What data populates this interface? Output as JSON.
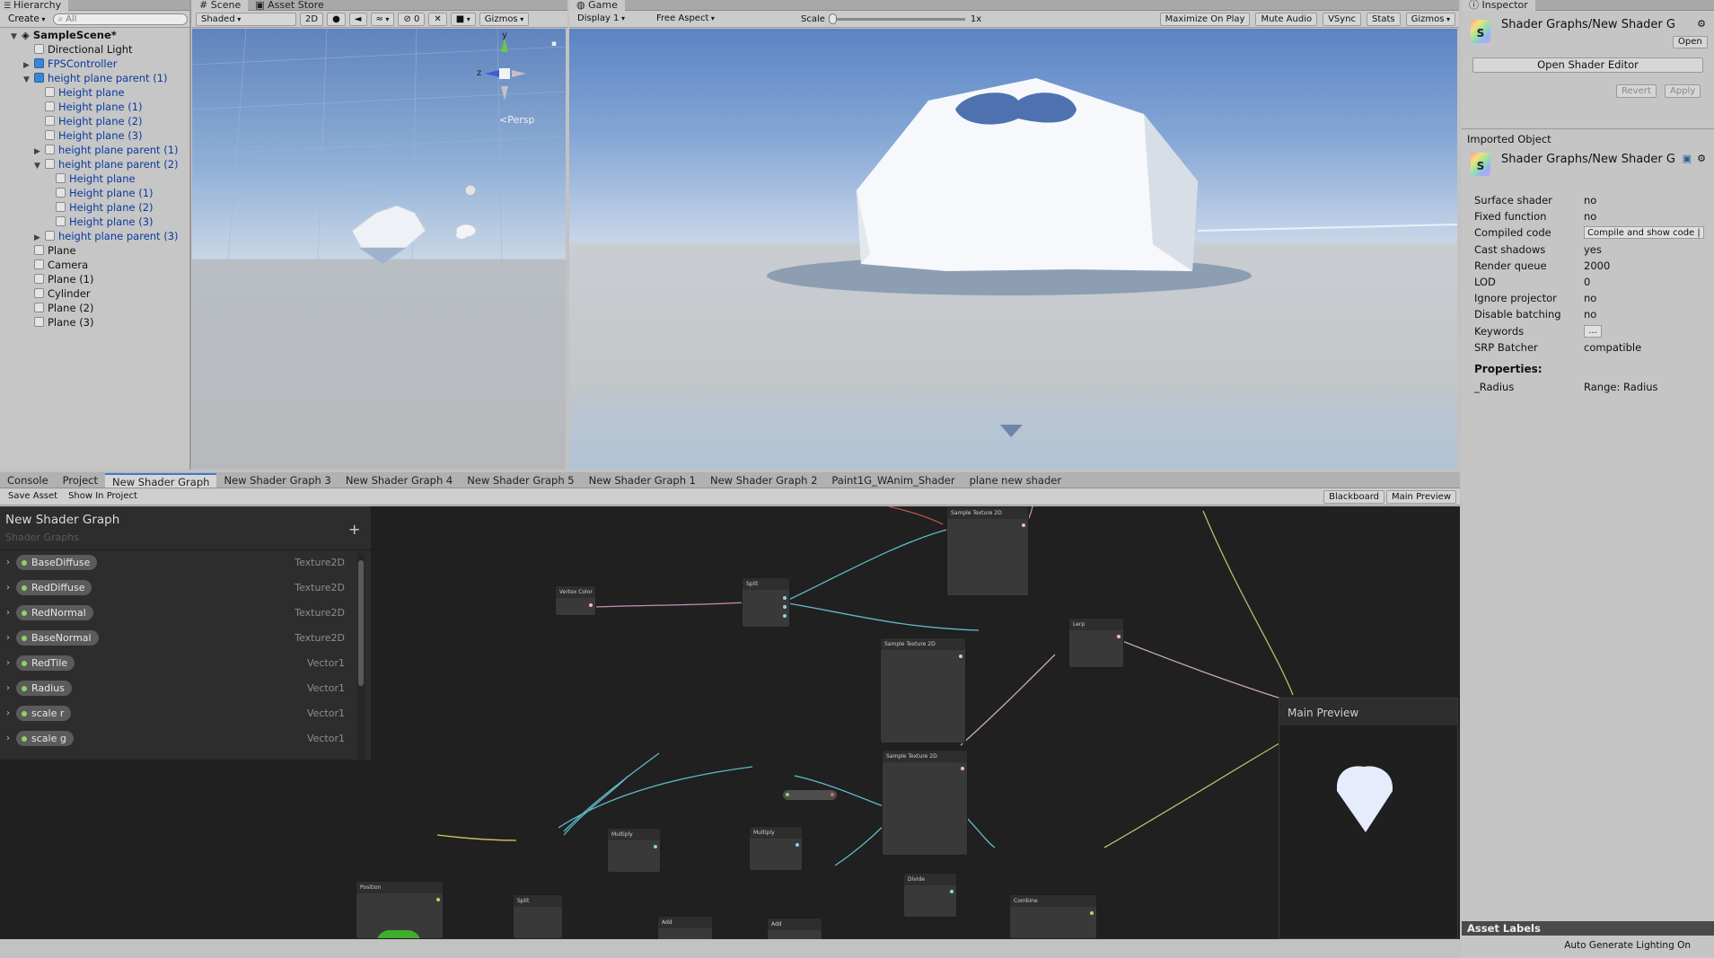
{
  "hierarchy": {
    "tab": "Hierarchy",
    "create_label": "Create",
    "search_placeholder": "All",
    "scene_name": "SampleScene*",
    "items": [
      {
        "label": "Directional Light"
      },
      {
        "label": "FPSController"
      },
      {
        "label": "height plane parent (1)"
      },
      {
        "label": "Height plane"
      },
      {
        "label": "Height plane (1)"
      },
      {
        "label": "Height plane (2)"
      },
      {
        "label": "Height plane (3)"
      },
      {
        "label": "height plane parent (1)"
      },
      {
        "label": "height plane parent (2)"
      },
      {
        "label": "Height plane"
      },
      {
        "label": "Height plane (1)"
      },
      {
        "label": "Height plane (2)"
      },
      {
        "label": "Height plane (3)"
      },
      {
        "label": "height plane parent (3)"
      },
      {
        "label": "Plane"
      },
      {
        "label": "Camera"
      },
      {
        "label": "Plane (1)"
      },
      {
        "label": "Cylinder"
      },
      {
        "label": "Plane (2)"
      },
      {
        "label": "Plane (3)"
      }
    ]
  },
  "scene": {
    "tab_scene": "Scene",
    "tab_asset_store": "Asset Store",
    "shading_mode": "Shaded",
    "mode_2d": "2D",
    "effects_count": "0",
    "gizmos": "Gizmos",
    "persp_label": "Persp",
    "axis_y": "y",
    "axis_z": "z"
  },
  "game": {
    "tab": "Game",
    "display": "Display 1",
    "aspect": "Free Aspect",
    "scale_label": "Scale",
    "scale_value": "1x",
    "maximize": "Maximize On Play",
    "mute": "Mute Audio",
    "vsync": "VSync",
    "stats": "Stats",
    "gizmos": "Gizmos"
  },
  "inspector": {
    "tab": "Inspector",
    "asset_title": "Shader Graphs/New Shader G",
    "open_label": "Open",
    "open_editor_label": "Open Shader Editor",
    "revert_label": "Revert",
    "apply_label": "Apply",
    "imported_object_label": "Imported Object",
    "imported_title": "Shader Graphs/New Shader G",
    "rows": [
      {
        "k": "Surface shader",
        "v": "no"
      },
      {
        "k": "Fixed function",
        "v": "no"
      },
      {
        "k": "Compiled code",
        "v": "Compile and show code |"
      },
      {
        "k": "Cast shadows",
        "v": "yes"
      },
      {
        "k": "Render queue",
        "v": "2000"
      },
      {
        "k": "LOD",
        "v": "0"
      },
      {
        "k": "Ignore projector",
        "v": "no"
      },
      {
        "k": "Disable batching",
        "v": "no"
      },
      {
        "k": "Keywords",
        "v": "..."
      },
      {
        "k": "SRP Batcher",
        "v": "compatible"
      }
    ],
    "properties_label": "Properties:",
    "prop_name": "_Radius",
    "prop_value": "Range: Radius",
    "asset_labels": "Asset Labels",
    "status": "Auto Generate Lighting On"
  },
  "bottom": {
    "tabs": [
      {
        "label": "Console"
      },
      {
        "label": "Project"
      },
      {
        "label": "New Shader Graph"
      },
      {
        "label": "New Shader Graph 3"
      },
      {
        "label": "New Shader Graph 4"
      },
      {
        "label": "New Shader Graph 5"
      },
      {
        "label": "New Shader Graph 1"
      },
      {
        "label": "New Shader Graph 2"
      },
      {
        "label": "Paint1G_WAnim_Shader"
      },
      {
        "label": "plane new shader"
      }
    ],
    "save_asset": "Save Asset",
    "show_in_project": "Show In Project",
    "blackboard_btn": "Blackboard",
    "main_preview_btn": "Main Preview"
  },
  "blackboard": {
    "title": "New Shader Graph",
    "subtitle": "Shader Graphs",
    "properties": [
      {
        "name": "BaseDiffuse",
        "type": "Texture2D"
      },
      {
        "name": "RedDiffuse",
        "type": "Texture2D"
      },
      {
        "name": "RedNormal",
        "type": "Texture2D"
      },
      {
        "name": "BaseNormal",
        "type": "Texture2D"
      },
      {
        "name": "RedTile",
        "type": "Vector1"
      },
      {
        "name": "Radius",
        "type": "Vector1"
      },
      {
        "name": "scale r",
        "type": "Vector1"
      },
      {
        "name": "scale g",
        "type": "Vector1"
      }
    ]
  },
  "graph": {
    "main_preview_title": "Main Preview",
    "nodes": {
      "vertex_color": "Vertex Color",
      "split": "Split",
      "sample_texture": "Sample Texture 2D",
      "lerp": "Lerp",
      "multiply": "Multiply",
      "add": "Add",
      "divide": "Divide",
      "combine": "Combine",
      "position": "Position"
    }
  },
  "colors": {
    "accent": "#3b7bd0",
    "graph_bg": "#202020",
    "sky_top": "#6e94c9",
    "sky_bottom": "#d9e3ee"
  }
}
